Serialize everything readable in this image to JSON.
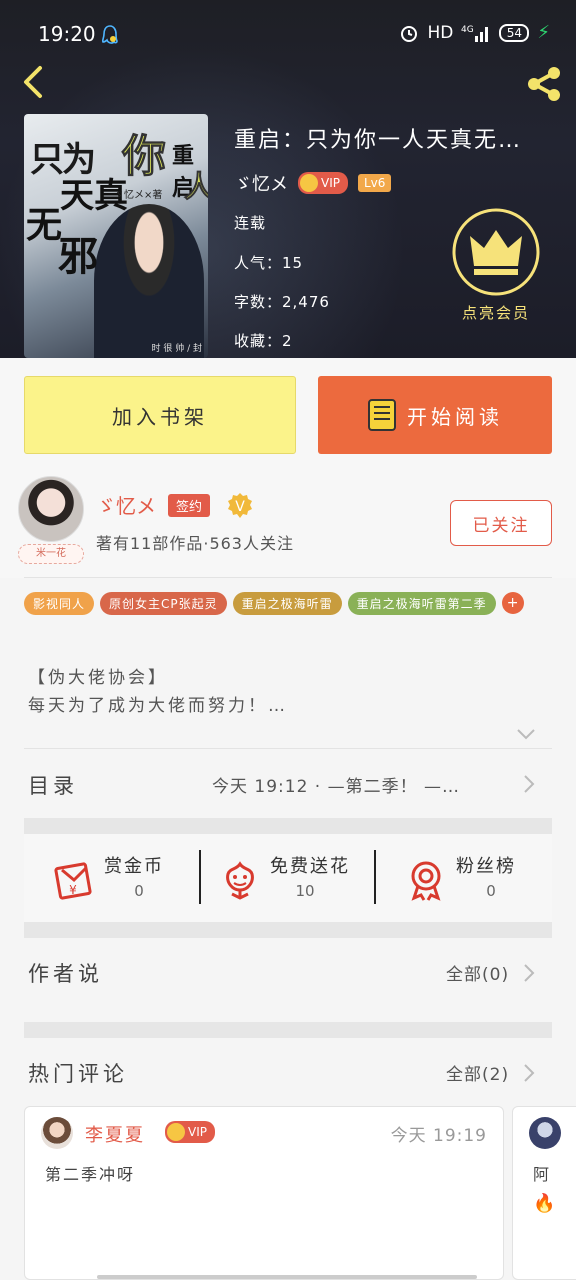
{
  "status_bar": {
    "time": "19:20",
    "hd": "HD",
    "network": "4G",
    "battery": "54"
  },
  "book": {
    "title": "重启：只为你一人天真无…",
    "author": "ゞ忆メ",
    "vip_label": "VIP",
    "level": "Lv6",
    "status": "连载",
    "popularity": "人气：15",
    "word_count": "字数：2,476",
    "favorites": "收藏：2",
    "cover_text": {
      "line1": "只为",
      "line2": "你",
      "line3": "重启",
      "line4": "天真",
      "line5": "人",
      "line6": "无",
      "line7": "邪",
      "byline": "ゞ忆メ×著",
      "publisher": "时 很 帅 / 封"
    }
  },
  "vip_promo": {
    "label": "点亮会员"
  },
  "actions": {
    "add_shelf": "加入书架",
    "start_reading": "开始阅读"
  },
  "author_card": {
    "avatar_tag": "米一花",
    "name": "ゞ忆メ",
    "signed": "签约",
    "verified": "V",
    "description": "著有11部作品·563人关注",
    "follow_button": "已关注"
  },
  "tags": [
    {
      "label": "影视同人",
      "color": "#f0a24a"
    },
    {
      "label": "原创女主CP张起灵",
      "color": "#d8674a"
    },
    {
      "label": "重启之极海听雷",
      "color": "#c89c3e"
    },
    {
      "label": "重启之极海听雷第二季",
      "color": "#8ab157"
    }
  ],
  "tag_more": "+",
  "intro": {
    "line1": "【伪大佬协会】",
    "line2": "每天为了成为大佬而努力！…"
  },
  "catalog": {
    "label": "目录",
    "latest": "今天 19:12 · —第二季！ —…"
  },
  "stats": [
    {
      "label": "赏金币",
      "value": "0",
      "icon": "red-envelope-icon"
    },
    {
      "label": "免费送花",
      "value": "10",
      "icon": "flower-icon"
    },
    {
      "label": "粉丝榜",
      "value": "0",
      "icon": "medal-icon"
    }
  ],
  "author_says": {
    "label": "作者说",
    "all": "全部(0)"
  },
  "hot_comments": {
    "label": "热门评论",
    "all": "全部(2)",
    "items": [
      {
        "name": "李夏夏",
        "vip": "VIP",
        "time": "今天 19:19",
        "text": "第二季冲呀"
      },
      {
        "text": "阿"
      }
    ]
  },
  "colors": {
    "accent": "#e25b49",
    "read_button": "#ec6a3e",
    "shelf_button": "#fbf38a",
    "vip_gold": "#f6e27a"
  }
}
